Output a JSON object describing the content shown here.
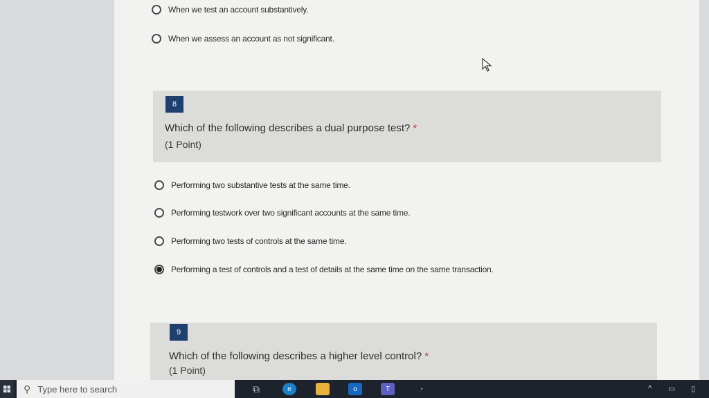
{
  "previous_question": {
    "options": [
      {
        "label": "When we test an account substantively.",
        "selected": false
      },
      {
        "label": "When we assess an account as not significant.",
        "selected": false
      }
    ]
  },
  "question_8": {
    "number": "8",
    "title": "Which of the following describes a dual purpose test?",
    "required_mark": "*",
    "points": "(1 Point)",
    "options": [
      {
        "label": "Performing two substantive tests at the same time.",
        "selected": false
      },
      {
        "label": "Performing testwork over two significant accounts at the same time.",
        "selected": false
      },
      {
        "label": "Performing two tests of controls at the same time.",
        "selected": false
      },
      {
        "label": "Performing a test of controls and a test of details at the same time on the same transaction.",
        "selected": true
      }
    ]
  },
  "question_9": {
    "number": "9",
    "title": "Which of the following describes a higher level control?",
    "required_mark": "*",
    "points": "(1 Point)"
  },
  "taskbar": {
    "search_placeholder": "Type here to search",
    "icons": [
      "task-view-icon",
      "edge-icon",
      "file-explorer-icon",
      "outlook-icon",
      "teams-icon"
    ]
  },
  "colors": {
    "question_number_bg": "#1f3f6e",
    "required_mark": "#c43b3b",
    "card_bg": "#dcdcda"
  }
}
